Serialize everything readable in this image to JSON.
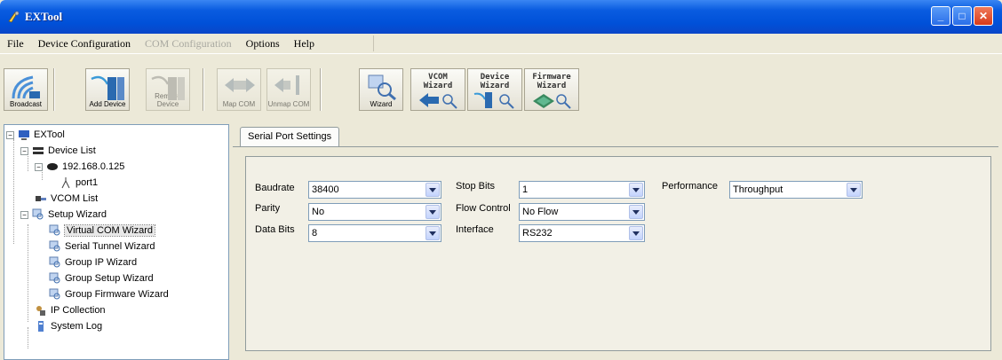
{
  "window": {
    "title": "EXTool"
  },
  "menu": [
    {
      "label": "File",
      "enabled": true
    },
    {
      "label": "Device Configuration",
      "enabled": true
    },
    {
      "label": "COM Configuration",
      "enabled": false
    },
    {
      "label": "Options",
      "enabled": true
    },
    {
      "label": "Help",
      "enabled": true
    }
  ],
  "toolbar": {
    "broadcast": "Broadcast",
    "add_device": "Add Device",
    "remove_device": "Remove Device",
    "map_com": "Map COM",
    "unmap_com": "Unmap COM",
    "wizard": "Wizard",
    "vcom_wizard": "VCOM\nWizard",
    "device_wizard": "Device\nWizard",
    "firmware_wizard": "Firmware\nWizard"
  },
  "tree": {
    "root": "EXTool",
    "device_list": "Device List",
    "device_ip": "192.168.0.125",
    "port": "port1",
    "vcom_list": "VCOM List",
    "setup_wizard": "Setup Wizard",
    "wizards": [
      "Virtual COM Wizard",
      "Serial Tunnel Wizard",
      "Group IP Wizard",
      "Group Setup Wizard",
      "Group Firmware Wizard"
    ],
    "ip_collection": "IP Collection",
    "system_log": "System Log"
  },
  "tab": {
    "label": "Serial Port Settings"
  },
  "settings": {
    "baudrate_label": "Baudrate",
    "baudrate": "38400",
    "parity_label": "Parity",
    "parity": "No",
    "data_bits_label": "Data Bits",
    "data_bits": "8",
    "stop_bits_label": "Stop Bits",
    "stop_bits": "1",
    "flow_control_label": "Flow Control",
    "flow_control": "No Flow",
    "interface_label": "Interface",
    "interface": "RS232",
    "performance_label": "Performance",
    "performance": "Throughput"
  },
  "colors": {
    "titlebar": "#0a5ce0",
    "face": "#ece9d8"
  }
}
